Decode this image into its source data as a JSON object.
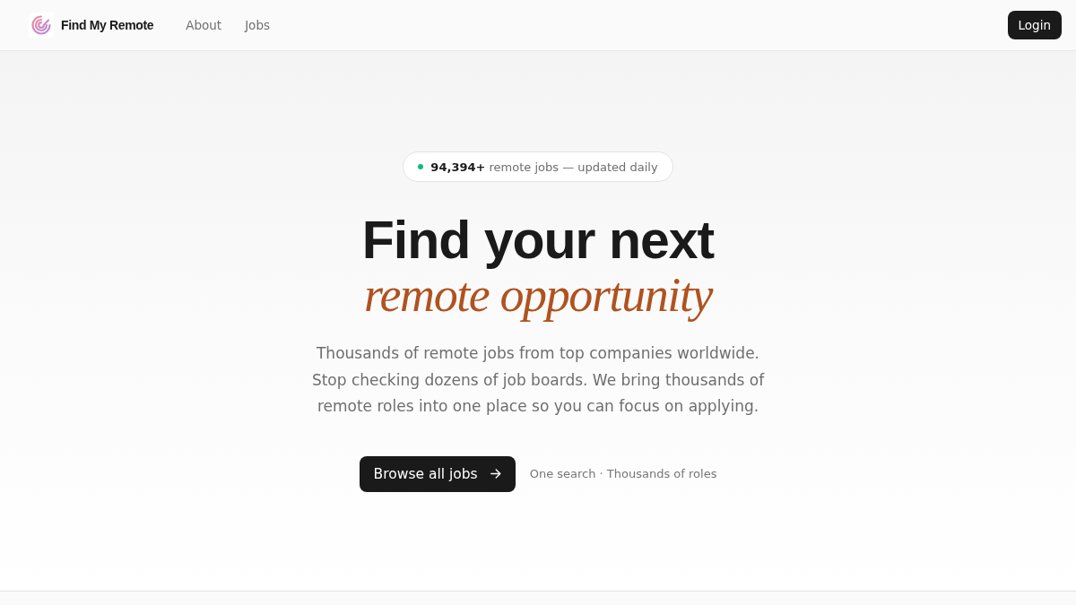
{
  "header": {
    "logo_text": "Find My Remote",
    "nav": [
      "About",
      "Jobs"
    ],
    "login": "Login"
  },
  "hero": {
    "badge": "**94,394+** remote jobs — updated daily",
    "title": "Find your next",
    "title_accent": "remote opportunity",
    "description": "Thousands of remote jobs from top companies worldwide. Stop checking dozens of job boards. We bring thousands of remote roles into one place so you can focus on applying.",
    "cta": "Browse all jobs",
    "cta_note": "One search · Thousands of roles"
  }
}
